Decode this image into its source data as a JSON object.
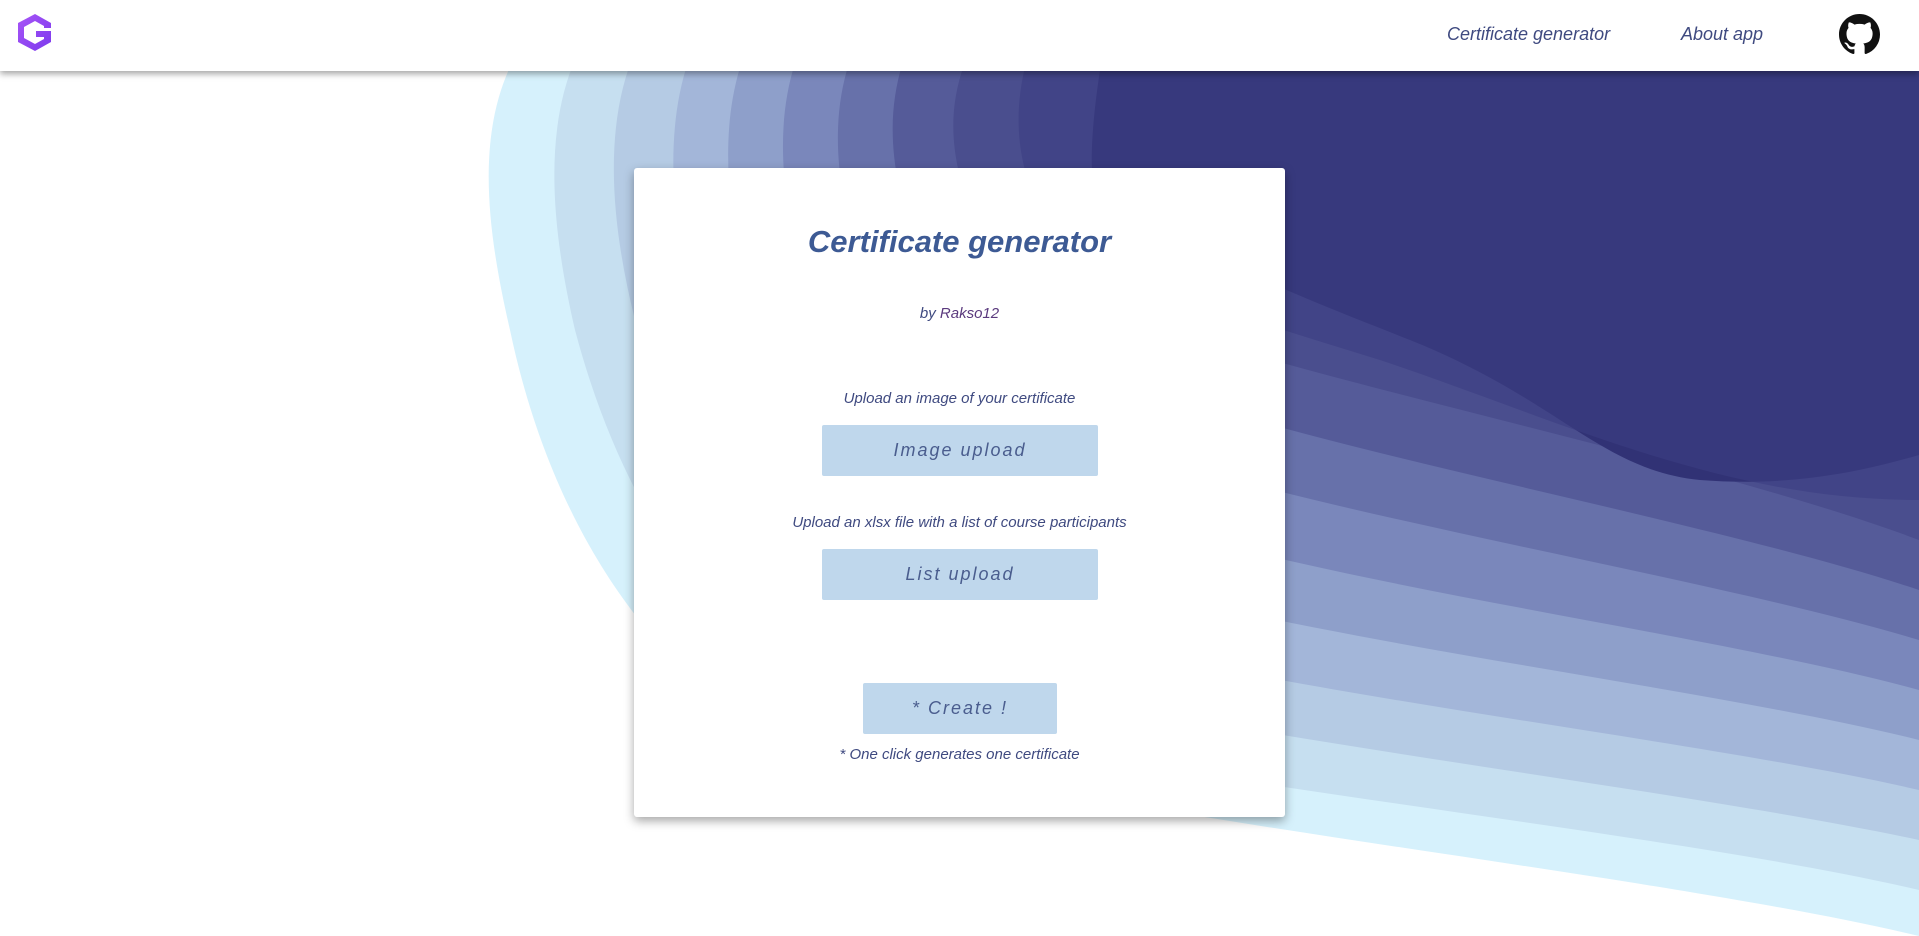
{
  "nav": {
    "logo_icon": "g-logo-icon",
    "links": [
      "Certificate generator",
      "About app"
    ],
    "github_icon": "github-icon"
  },
  "card": {
    "title": "Certificate generator",
    "by_prefix": "by ",
    "author": "Rakso12",
    "image_label": "Upload an image of your certificate",
    "image_button": "Image upload",
    "list_label": "Upload an xlsx file with a list of course participants",
    "list_button": "List upload",
    "create_button": "* Create !",
    "note": "* One click generates one certificate"
  },
  "colors": {
    "wave_dark": "#313275",
    "wave_light": "#d6f1fc",
    "button_bg": "#bfd7ec",
    "title": "#3d5a94",
    "logo": "#8b5cf6"
  }
}
